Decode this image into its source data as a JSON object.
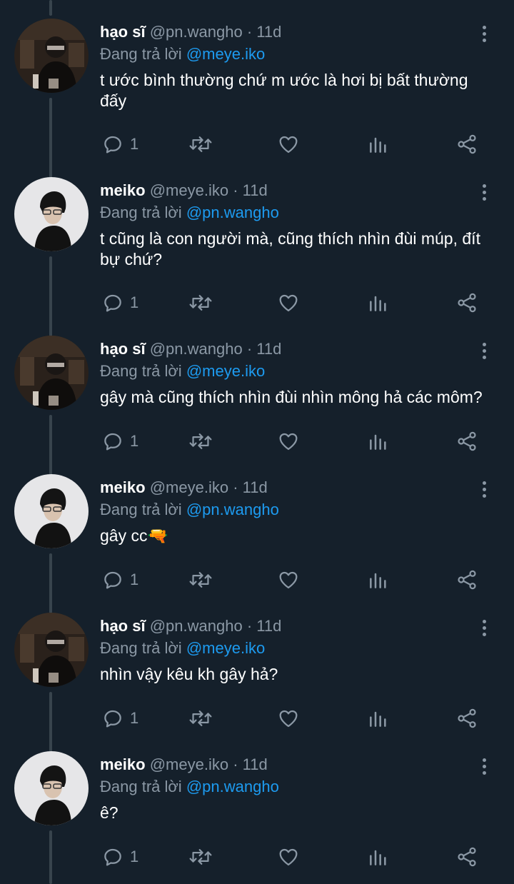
{
  "tweets": [
    {
      "author": "hao",
      "name": "hạo sĩ",
      "handle": "@pn.wangho",
      "separator": "·",
      "time": "11d",
      "replying_prefix": "Đang trả lời",
      "replying_to": "@meye.iko",
      "text": "t ước bình thường chứ m ước là hơi bị bất thường đấy",
      "reply_count": "1"
    },
    {
      "author": "meiko",
      "name": "meiko",
      "handle": "@meye.iko",
      "separator": "·",
      "time": "11d",
      "replying_prefix": "Đang trả lời",
      "replying_to": "@pn.wangho",
      "text": "t cũng là con người mà, cũng thích nhìn đùi múp, đít bự chứ?",
      "reply_count": "1"
    },
    {
      "author": "hao",
      "name": "hạo sĩ",
      "handle": "@pn.wangho",
      "separator": "·",
      "time": "11d",
      "replying_prefix": "Đang trả lời",
      "replying_to": "@meye.iko",
      "text": "gây mà cũng thích nhìn đùi nhìn mông hả các môm?",
      "reply_count": "1"
    },
    {
      "author": "meiko",
      "name": "meiko",
      "handle": "@meye.iko",
      "separator": "·",
      "time": "11d",
      "replying_prefix": "Đang trả lời",
      "replying_to": "@pn.wangho",
      "text": "gây cc🔫",
      "reply_count": "1"
    },
    {
      "author": "hao",
      "name": "hạo sĩ",
      "handle": "@pn.wangho",
      "separator": "·",
      "time": "11d",
      "replying_prefix": "Đang trả lời",
      "replying_to": "@meye.iko",
      "text": "nhìn vậy kêu kh gây hả?",
      "reply_count": "1"
    },
    {
      "author": "meiko",
      "name": "meiko",
      "handle": "@meye.iko",
      "separator": "·",
      "time": "11d",
      "replying_prefix": "Đang trả lời",
      "replying_to": "@pn.wangho",
      "text": "ê?",
      "reply_count": "1"
    }
  ],
  "icons": {
    "reply": "reply-icon",
    "retweet": "retweet-icon",
    "like": "like-icon",
    "views": "views-icon",
    "share": "share-icon",
    "more": "more-options-icon"
  },
  "colors": {
    "background": "#15202b",
    "text": "#ffffff",
    "secondary": "#8b98a5",
    "link": "#1d9bf0",
    "thread_line": "#38444d"
  }
}
